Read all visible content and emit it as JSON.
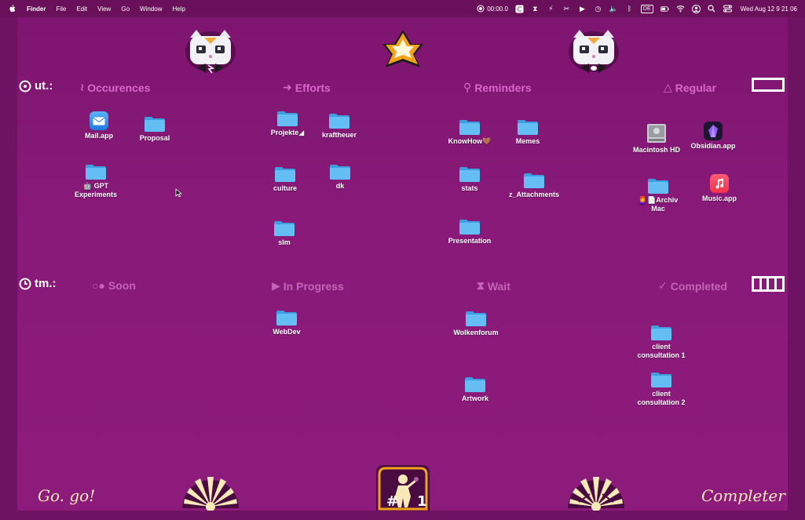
{
  "menubar": {
    "app_name": "Finder",
    "menus": [
      "File",
      "Edit",
      "View",
      "Go",
      "Window",
      "Help"
    ],
    "timer": "00:00.0",
    "lang": "DE",
    "clock": "Wed Aug 12  9 21 06"
  },
  "rows": [
    {
      "label": "ut.:",
      "icon": "target-icon"
    },
    {
      "label": "tm.:",
      "icon": "clock-icon"
    }
  ],
  "headers_top": [
    {
      "glyph": "≀",
      "label": "Occurences"
    },
    {
      "glyph": "➜",
      "label": "Efforts"
    },
    {
      "glyph": "⚲",
      "label": "Reminders"
    },
    {
      "glyph": "△",
      "label": "Regular"
    }
  ],
  "headers_bottom": [
    {
      "glyph": "○●",
      "label": "Soon"
    },
    {
      "glyph": "▶",
      "label": "In Progress"
    },
    {
      "glyph": "⧗",
      "label": "Wait"
    },
    {
      "glyph": "✓",
      "label": "Completed"
    }
  ],
  "items": {
    "mail": "Mail.app",
    "proposal": "Proposal",
    "gpt": "🤖 GPT\nExperiments",
    "projekte": "Projekte◢",
    "kraftheuer": "kraftheuer",
    "culture": "culture",
    "dk": "dk",
    "slm": "slm",
    "knowhow": "KnowHow🤎",
    "memes": "Memes",
    "stats": "stats",
    "attachments": "z_Attachments",
    "presentation": "Presentation",
    "macintosh": "Macintosh HD",
    "obsidian": "Obsidian.app",
    "archiv": "👩‍🦰📄Archiv\nMac",
    "music": "Music.app",
    "webdev": "WebDev",
    "wolkenforum": "Wolkenforum",
    "artwork": "Artwork",
    "client1": "client\nconsultation 1",
    "client2": "client\nconsultation 2"
  },
  "bottom": {
    "left_text": "Go. go!",
    "right_text": "Completer",
    "badge_hash": "#",
    "badge_num": "1"
  },
  "colors": {
    "background": "#7e1570",
    "header": "#d968c9",
    "folder": "#5ab4ef",
    "accent_cream": "#f7e9b8"
  }
}
